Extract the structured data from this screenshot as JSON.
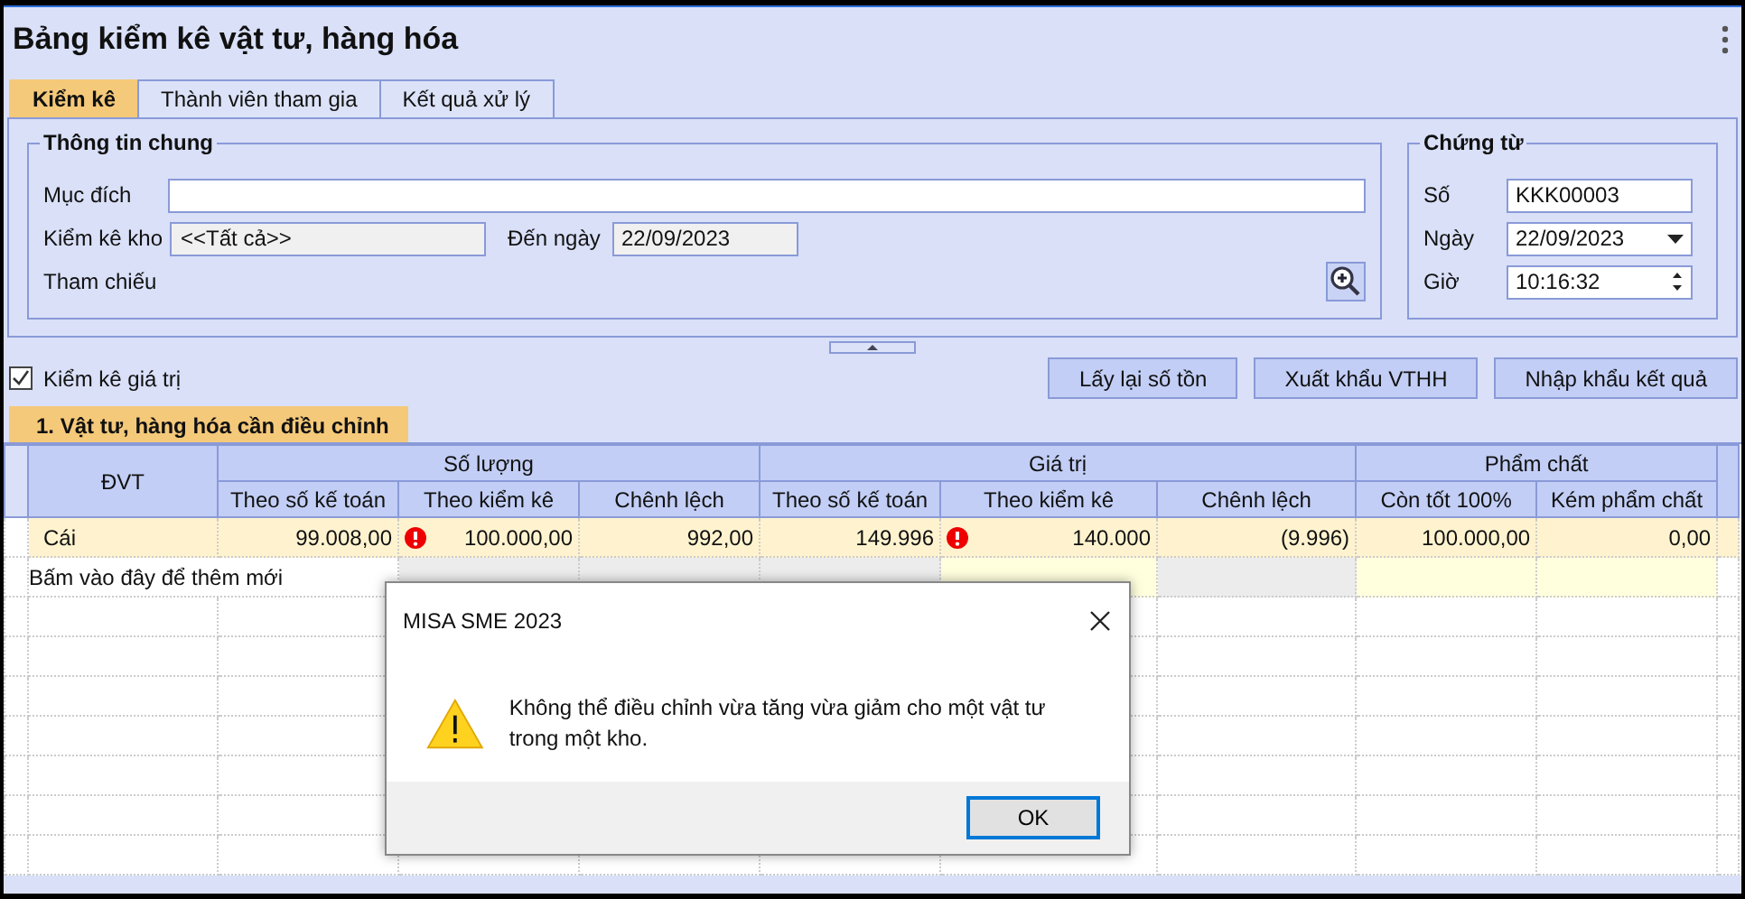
{
  "window": {
    "title": "Bảng kiểm kê vật tư, hàng hóa"
  },
  "tabs": [
    {
      "label": "Kiểm kê",
      "selected": true
    },
    {
      "label": "Thành viên tham gia",
      "selected": false
    },
    {
      "label": "Kết quả xử lý",
      "selected": false
    }
  ],
  "general": {
    "title": "Thông tin chung",
    "purpose_label": "Mục đích",
    "warehouse_label": "Kiểm kê kho",
    "warehouse": "<<Tất cả>>",
    "to_date_label": "Đến ngày",
    "to_date": "22/09/2023",
    "reference_label": "Tham chiếu"
  },
  "voucher": {
    "title": "Chứng từ",
    "number_label": "Số",
    "number": "KKK00003",
    "date_label": "Ngày",
    "date": "22/09/2023",
    "time_label": "Giờ",
    "time": "10:16:32"
  },
  "value_check": {
    "label": "Kiểm kê giá trị",
    "checked": true
  },
  "buttons": [
    "Lấy lại số tồn",
    "Xuất khẩu VTHH",
    "Nhập khẩu kết quả"
  ],
  "section_tab": {
    "label": "1. Vật tư, hàng hóa cần điều chỉnh",
    "selected": true
  },
  "table": {
    "unit_column": "ĐVT",
    "groups": [
      {
        "label": "Số lượng",
        "columns": [
          "Theo số kế toán",
          "Theo kiểm kê",
          "Chênh lệch"
        ]
      },
      {
        "label": "Giá trị",
        "columns": [
          "Theo số kế toán",
          "Theo kiểm kê",
          "Chênh lệch"
        ]
      },
      {
        "label": "Phẩm chất",
        "columns": [
          "Còn tốt 100%",
          "Kém phẩm chất"
        ]
      }
    ],
    "rows": [
      {
        "unit": "Cái",
        "cells": [
          {
            "value": "99.008,00",
            "error": false
          },
          {
            "value": "100.000,00",
            "error": true
          },
          {
            "value": "992,00",
            "error": false
          },
          {
            "value": "149.996",
            "error": false
          },
          {
            "value": "140.000",
            "error": true
          },
          {
            "value": "(9.996)",
            "error": false
          },
          {
            "value": "100.000,00",
            "error": false
          },
          {
            "value": "0,00",
            "error": false
          }
        ]
      }
    ],
    "add_row": "Bấm vào đây để thêm mới"
  },
  "dialog": {
    "title": "MISA SME 2023",
    "message": "Không thể điều chỉnh vừa tăng vừa giảm cho một vật tư trong một kho.",
    "button": "OK"
  }
}
